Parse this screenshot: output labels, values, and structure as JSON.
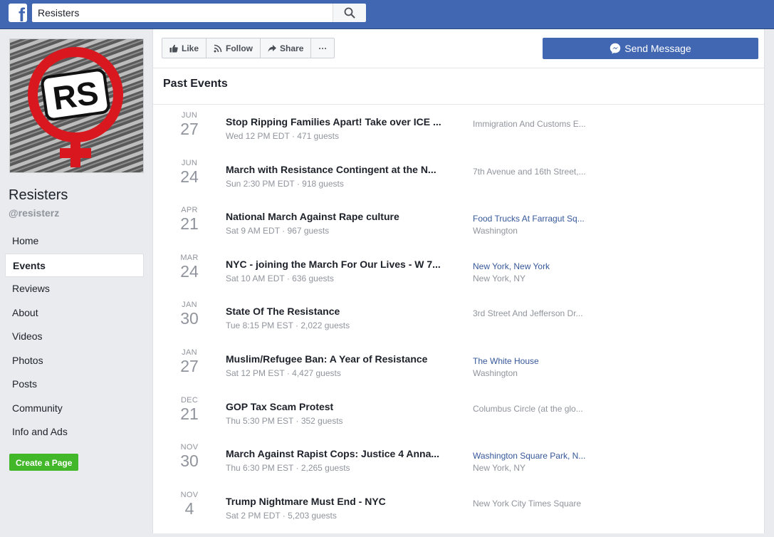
{
  "topbar": {
    "logo_letter": "f",
    "search_value": "Resisters",
    "search_icon": "magnifier-icon"
  },
  "page": {
    "name": "Resisters",
    "handle": "@resisterz",
    "profile_badge": "RS"
  },
  "nav": [
    {
      "label": "Home",
      "active": false
    },
    {
      "label": "Events",
      "active": true
    },
    {
      "label": "Reviews",
      "active": false
    },
    {
      "label": "About",
      "active": false
    },
    {
      "label": "Videos",
      "active": false
    },
    {
      "label": "Photos",
      "active": false
    },
    {
      "label": "Posts",
      "active": false
    },
    {
      "label": "Community",
      "active": false
    },
    {
      "label": "Info and Ads",
      "active": false
    }
  ],
  "create_page_label": "Create a Page",
  "actions": {
    "like": "Like",
    "follow": "Follow",
    "share": "Share",
    "more": "···",
    "send_message": "Send Message"
  },
  "section_title": "Past Events",
  "events": [
    {
      "month": "JUN",
      "day": "27",
      "title": "Stop Ripping Families Apart! Take over ICE ...",
      "meta": "Wed 12 PM EDT · 471 guests",
      "location": "Immigration And Customs E...",
      "location_link": false,
      "location_sub": ""
    },
    {
      "month": "JUN",
      "day": "24",
      "title": "March with Resistance Contingent at the N...",
      "meta": "Sun 2:30 PM EDT · 918 guests",
      "location": "7th Avenue and 16th Street,...",
      "location_link": false,
      "location_sub": ""
    },
    {
      "month": "APR",
      "day": "21",
      "title": "National March Against Rape culture",
      "meta": "Sat 9 AM EDT · 967 guests",
      "location": "Food Trucks At Farragut Sq...",
      "location_link": true,
      "location_sub": "Washington"
    },
    {
      "month": "MAR",
      "day": "24",
      "title": "NYC - joining the March For Our Lives - W 7...",
      "meta": "Sat 10 AM EDT · 636 guests",
      "location": "New York, New York",
      "location_link": true,
      "location_sub": "New York, NY"
    },
    {
      "month": "JAN",
      "day": "30",
      "title": "State Of The Resistance",
      "meta": "Tue 8:15 PM EST · 2,022 guests",
      "location": "3rd Street And Jefferson Dr...",
      "location_link": false,
      "location_sub": ""
    },
    {
      "month": "JAN",
      "day": "27",
      "title": "Muslim/Refugee Ban: A Year of Resistance",
      "meta": "Sat 12 PM EST · 4,427 guests",
      "location": "The White House",
      "location_link": true,
      "location_sub": "Washington"
    },
    {
      "month": "DEC",
      "day": "21",
      "title": "GOP Tax Scam Protest",
      "meta": "Thu 5:30 PM EST · 352 guests",
      "location": "Columbus Circle (at the glo...",
      "location_link": false,
      "location_sub": ""
    },
    {
      "month": "NOV",
      "day": "30",
      "title": "March Against Rapist Cops: Justice 4 Anna...",
      "meta": "Thu 6:30 PM EST · 2,265 guests",
      "location": "Washington Square Park, N...",
      "location_link": true,
      "location_sub": "New York, NY"
    },
    {
      "month": "NOV",
      "day": "4",
      "title": "Trump Nightmare Must End - NYC",
      "meta": "Sat 2 PM EDT · 5,203 guests",
      "location": "New York City Times Square",
      "location_link": false,
      "location_sub": ""
    }
  ],
  "colors": {
    "brand_blue": "#4267b2",
    "link_blue": "#365899",
    "create_green": "#42b72a"
  }
}
